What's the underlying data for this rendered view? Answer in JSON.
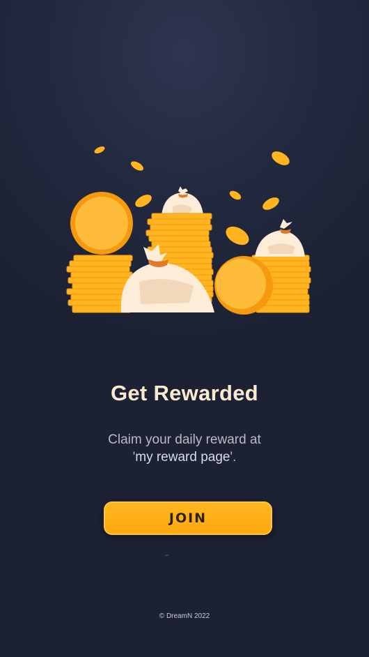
{
  "hero": {
    "illustration": "coins-and-money-bags-illustration"
  },
  "title": "Get Rewarded",
  "description": {
    "line1": "Claim your daily reward at",
    "line2_prefix": "'",
    "line2_link": "my reward page",
    "line2_suffix": "'."
  },
  "join_button": {
    "label": "JOIN"
  },
  "footer": {
    "copyright": "© DreamN 2022"
  },
  "colors": {
    "background": "#232a40",
    "title": "#fbead0",
    "accent": "#ffad14",
    "coin": "#ffb833",
    "bag": "#fcecd8"
  }
}
